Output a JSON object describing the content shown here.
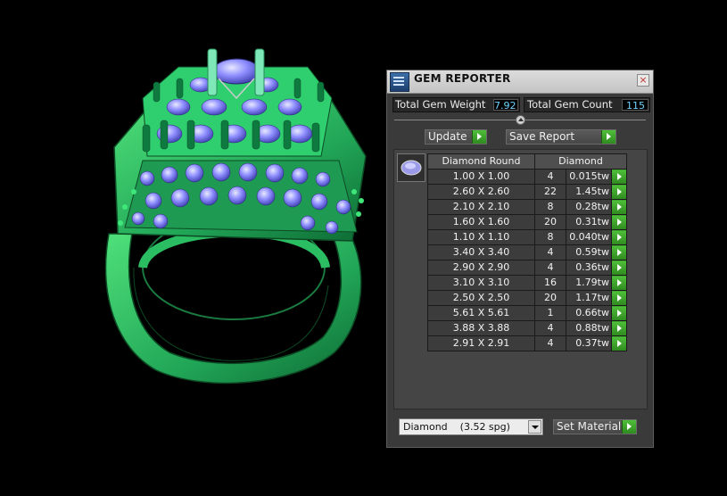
{
  "window": {
    "title": "GEM REPORTER",
    "close_glyph": "×"
  },
  "stats": {
    "total_gem_weight_label": "Total Gem Weight",
    "total_gem_weight_value": "7.92",
    "total_gem_count_label": "Total Gem Count",
    "total_gem_count_value": "115"
  },
  "actions": {
    "update_label": "Update",
    "save_report_label": "Save Report",
    "set_material_label": "Set Material"
  },
  "table": {
    "headers": [
      "Diamond Round",
      "Diamond"
    ],
    "rows": [
      {
        "size": "1.00 X 1.00",
        "count": "4",
        "weight": "0.015tw"
      },
      {
        "size": "2.60 X 2.60",
        "count": "22",
        "weight": "1.45tw"
      },
      {
        "size": "2.10 X 2.10",
        "count": "8",
        "weight": "0.28tw"
      },
      {
        "size": "1.60 X 1.60",
        "count": "20",
        "weight": "0.31tw"
      },
      {
        "size": "1.10 X 1.10",
        "count": "8",
        "weight": "0.040tw"
      },
      {
        "size": "3.40 X 3.40",
        "count": "4",
        "weight": "0.59tw"
      },
      {
        "size": "2.90 X 2.90",
        "count": "4",
        "weight": "0.36tw"
      },
      {
        "size": "3.10 X 3.10",
        "count": "16",
        "weight": "1.79tw"
      },
      {
        "size": "2.50 X 2.50",
        "count": "20",
        "weight": "1.17tw"
      },
      {
        "size": "5.61 X 5.61",
        "count": "1",
        "weight": "0.66tw"
      },
      {
        "size": "3.88 X 3.88",
        "count": "4",
        "weight": "0.88tw"
      },
      {
        "size": "2.91 X 2.91",
        "count": "4",
        "weight": "0.37tw"
      }
    ]
  },
  "material": {
    "selected": "Diamond    (3.52 spg)"
  },
  "icons": {
    "app": "gem-reporter-app-icon",
    "close": "close-icon",
    "gem_thumbnail": "round-diamond-icon",
    "go": "green-arrow-icon",
    "dropdown": "chevron-down-icon"
  },
  "colors": {
    "background": "#000000",
    "panel": "#3a3a3a",
    "value_text": "#6fd3ff",
    "arrow_button": "#3faa2c",
    "ring_metal": "#25a85c",
    "gem_stones": "#8c8cff"
  }
}
